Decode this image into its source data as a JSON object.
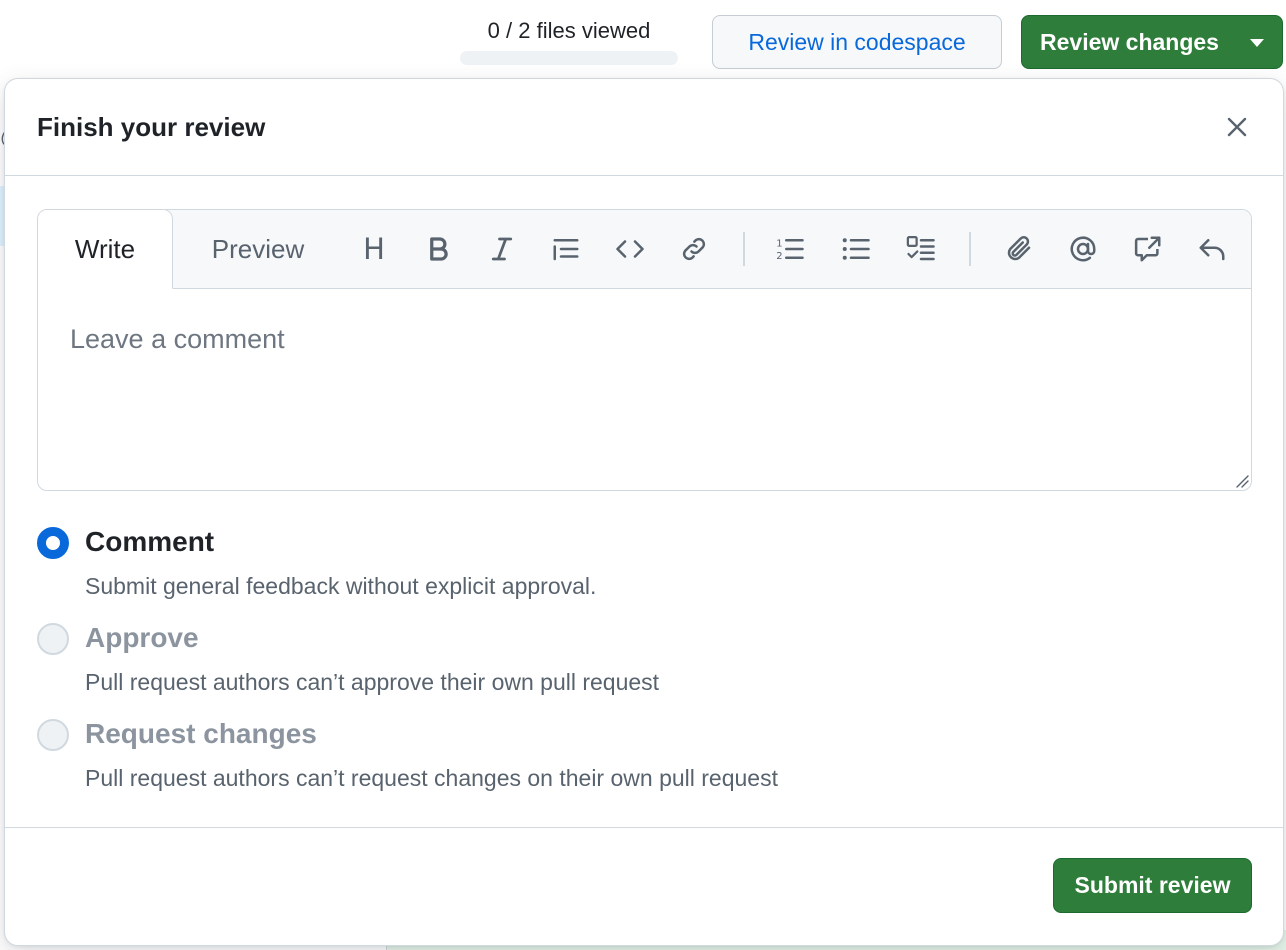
{
  "header": {
    "files_viewed_text": "0 / 2 files viewed",
    "files_viewed_fraction": 0,
    "codespace_button_label": "Review in codespace",
    "review_changes_button_label": "Review changes"
  },
  "background": {
    "bottom_text": "+ | +"
  },
  "review_dialog": {
    "title": "Finish your review",
    "editor": {
      "tabs": [
        {
          "label": "Write",
          "selected": true
        },
        {
          "label": "Preview",
          "selected": false
        }
      ],
      "toolbar_icons": [
        "heading-icon",
        "bold-icon",
        "italic-icon",
        "quote-icon",
        "code-icon",
        "link-icon",
        "ordered-list-icon",
        "unordered-list-icon",
        "task-list-icon",
        "attach-icon",
        "mention-icon",
        "cross-reference-icon",
        "saved-reply-icon"
      ],
      "heading_glyph": "H",
      "placeholder": "Leave a comment",
      "value": ""
    },
    "options": [
      {
        "label": "Comment",
        "description": "Submit general feedback without explicit approval.",
        "selected": true,
        "disabled": false
      },
      {
        "label": "Approve",
        "description": "Pull request authors can’t approve their own pull request",
        "selected": false,
        "disabled": true
      },
      {
        "label": "Request changes",
        "description": "Pull request authors can’t request changes on their own pull request",
        "selected": false,
        "disabled": true
      }
    ],
    "submit_button_label": "Submit review"
  },
  "colors": {
    "primary_green": "#2e7d3a",
    "link_blue": "#0969da",
    "border": "#d1d9e0",
    "muted_text": "#59636e"
  }
}
